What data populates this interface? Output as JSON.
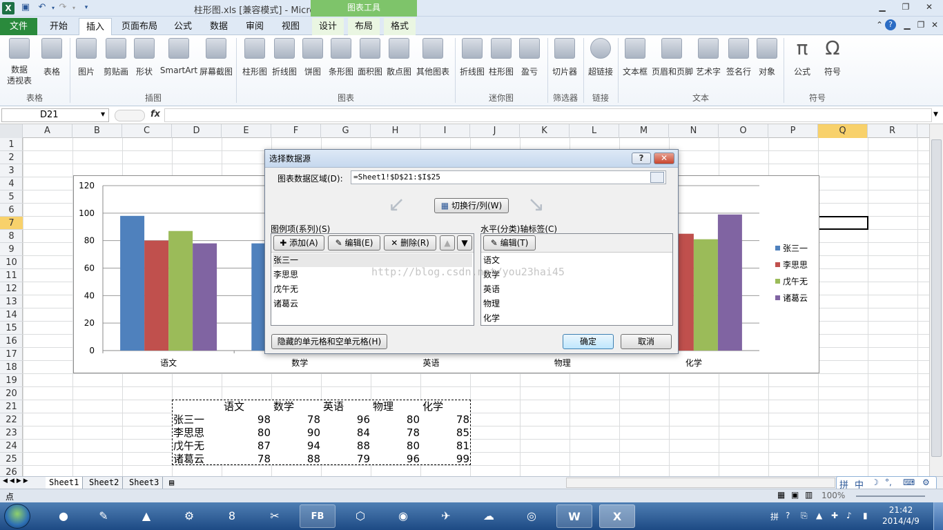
{
  "window": {
    "title": "柱形图.xls [兼容模式] - Microsoft Excel",
    "context_tab_group": "图表工具"
  },
  "ribbon": {
    "tabs": [
      "文件",
      "开始",
      "插入",
      "页面布局",
      "公式",
      "数据",
      "审阅",
      "视图",
      "设计",
      "布局",
      "格式"
    ],
    "groups": {
      "tables": {
        "label": "表格",
        "buttons": [
          "数据\n透视表",
          "表格"
        ]
      },
      "illustrations": {
        "label": "插图",
        "buttons": [
          "图片",
          "剪贴画",
          "形状",
          "SmartArt",
          "屏幕截图"
        ]
      },
      "charts": {
        "label": "图表",
        "buttons": [
          "柱形图",
          "折线图",
          "饼图",
          "条形图",
          "面积图",
          "散点图",
          "其他图表"
        ]
      },
      "sparklines": {
        "label": "迷你图",
        "buttons": [
          "折线图",
          "柱形图",
          "盈亏"
        ]
      },
      "filter": {
        "label": "筛选器",
        "buttons": [
          "切片器"
        ]
      },
      "links": {
        "label": "链接",
        "buttons": [
          "超链接"
        ]
      },
      "text": {
        "label": "文本",
        "buttons": [
          "文本框",
          "页眉和页脚",
          "艺术字",
          "签名行",
          "对象"
        ]
      },
      "symbols": {
        "label": "符号",
        "buttons": [
          "公式",
          "符号"
        ]
      }
    }
  },
  "formula_bar": {
    "name_box": "D21",
    "fx": "fx",
    "formula": ""
  },
  "grid": {
    "columns": [
      "A",
      "B",
      "C",
      "D",
      "E",
      "F",
      "G",
      "H",
      "I",
      "J",
      "K",
      "L",
      "M",
      "N",
      "O",
      "P",
      "Q",
      "R"
    ],
    "selected_column": "Q",
    "rows": [
      "1",
      "2",
      "3",
      "4",
      "5",
      "6",
      "7",
      "8",
      "9",
      "10",
      "11",
      "12",
      "13",
      "14",
      "15",
      "16",
      "17",
      "18",
      "19",
      "20",
      "21",
      "22",
      "23",
      "24",
      "25",
      "26"
    ],
    "selected_row": "7"
  },
  "chart_data": {
    "type": "bar",
    "categories": [
      "语文",
      "数学",
      "英语",
      "物理",
      "化学"
    ],
    "series": [
      {
        "name": "张三一",
        "values": [
          98,
          78,
          96,
          80,
          78
        ],
        "color": "#4f81bd"
      },
      {
        "name": "李思思",
        "values": [
          80,
          90,
          84,
          78,
          85
        ],
        "color": "#c0504d"
      },
      {
        "name": "戊午无",
        "values": [
          87,
          94,
          88,
          80,
          81
        ],
        "color": "#9bbb59"
      },
      {
        "name": "诸葛云",
        "values": [
          78,
          88,
          79,
          96,
          99
        ],
        "color": "#8064a2"
      }
    ],
    "ylim": [
      0,
      120
    ],
    "yticks": [
      "0",
      "20",
      "40",
      "60",
      "80",
      "100",
      "120"
    ],
    "grid": true,
    "legend": "right"
  },
  "table": {
    "headers": [
      "语文",
      "数学",
      "英语",
      "物理",
      "化学"
    ],
    "rows": [
      {
        "name": "张三一",
        "values": [
          "98",
          "78",
          "96",
          "80",
          "78"
        ]
      },
      {
        "name": "李思思",
        "values": [
          "80",
          "90",
          "84",
          "78",
          "85"
        ]
      },
      {
        "name": "戊午无",
        "values": [
          "87",
          "94",
          "88",
          "80",
          "81"
        ]
      },
      {
        "name": "诸葛云",
        "values": [
          "78",
          "88",
          "79",
          "96",
          "99"
        ]
      }
    ]
  },
  "dialog": {
    "title": "选择数据源",
    "help": "?",
    "close": "✕",
    "range_label": "图表数据区域(D):",
    "range_value": "=Sheet1!$D$21:$I$25",
    "switch_label": "切换行/列(W)",
    "legend_label": "图例项(系列)(S)",
    "add_label": "添加(A)",
    "edit_label": "编辑(E)",
    "delete_label": "删除(R)",
    "series_items": [
      "张三一",
      "李思思",
      "戊午无",
      "诸葛云"
    ],
    "axis_label": "水平(分类)轴标签(C)",
    "axis_edit_label": "编辑(T)",
    "axis_items": [
      "语文",
      "数学",
      "英语",
      "物理",
      "化学"
    ],
    "hidden_cells_label": "隐藏的单元格和空单元格(H)",
    "ok_label": "确定",
    "cancel_label": "取消"
  },
  "watermark": "http://blog.csdn.net/you23hai45",
  "sheets": [
    "Sheet1",
    "Sheet2",
    "Sheet3"
  ],
  "status": {
    "mode": "点",
    "zoom": "100%"
  },
  "taskbar": {
    "time": "21:42",
    "date": "2014/4/9"
  }
}
